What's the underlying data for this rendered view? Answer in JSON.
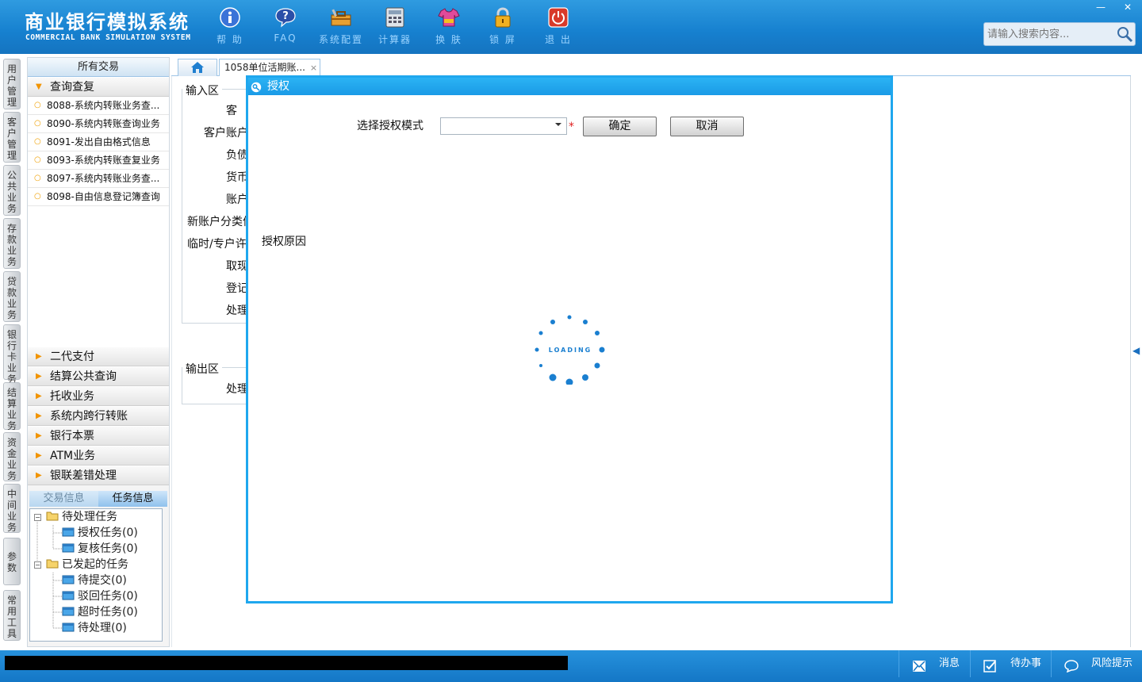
{
  "header": {
    "title_cn": "商业银行模拟系统",
    "title_en": "COMMERCIAL BANK SIMULATION SYSTEM",
    "tools": [
      {
        "label": "帮 助",
        "icon": "info-icon"
      },
      {
        "label": "FAQ",
        "icon": "question-icon"
      },
      {
        "label": "系统配置",
        "icon": "toolbox-icon"
      },
      {
        "label": "计算器",
        "icon": "calculator-icon"
      },
      {
        "label": "换 肤",
        "icon": "tshirt-icon"
      },
      {
        "label": "锁 屏",
        "icon": "lock-icon"
      },
      {
        "label": "退 出",
        "icon": "power-icon"
      }
    ],
    "window_min": "—",
    "window_close": "✕",
    "search_placeholder": "请输入搜索内容..."
  },
  "vtabs": [
    "用户管理",
    "客户管理",
    "公共业务",
    "存款业务",
    "贷款业务",
    "银行卡业务",
    "结算业务",
    "资金业务",
    "中间业务",
    "参数",
    "常用工具"
  ],
  "sidenav": {
    "header": "所有交易",
    "open_section": "查询查复",
    "items": [
      "8088-系统内转账业务查...",
      "8090-系统内转账查询业务",
      "8091-发出自由格式信息",
      "8093-系统内转账查复业务",
      "8097-系统内转账业务查...",
      "8098-自由信息登记簿查询"
    ],
    "sections": [
      "二代支付",
      "结算公共查询",
      "托收业务",
      "系统内跨行转账",
      "银行本票",
      "ATM业务",
      "银联差错处理"
    ]
  },
  "task_panel": {
    "tabs": [
      "交易信息",
      "任务信息"
    ],
    "tree": [
      {
        "label": "待处理任务",
        "children": [
          "授权任务(0)",
          "复核任务(0)"
        ]
      },
      {
        "label": "已发起的任务",
        "children": [
          "待提交(0)",
          "驳回任务(0)",
          "超时任务(0)",
          "待处理(0)"
        ]
      }
    ]
  },
  "content": {
    "doc_tab": "1058单位活期账...",
    "doc_tab_close": "×",
    "input_group_title": "输入区",
    "input_labels": [
      "客",
      "客户账户",
      "负债",
      "货币",
      "账户",
      "新账户分类信",
      "临时/专户许",
      "取现",
      "登记",
      "处理"
    ],
    "output_group_title": "输出区",
    "output_labels": [
      "处理"
    ]
  },
  "modal": {
    "title": "授权",
    "mode_label": "选择授权模式",
    "mode_value": "",
    "required_mark": "*",
    "confirm": "确定",
    "cancel": "取消",
    "reason_label": "授权原因",
    "loading_text": "LOADING"
  },
  "statusbar": {
    "items": [
      {
        "label": "消息",
        "icon": "mail-icon"
      },
      {
        "label": "待办事项",
        "icon": "checkbox-icon"
      },
      {
        "label": "风险提示",
        "icon": "chat-icon"
      }
    ]
  },
  "colors": {
    "header_blue": "#1680cf",
    "modal_border": "#1fa7ee",
    "accent_orange": "#f29400",
    "loader_blue": "#1a7fd0"
  }
}
